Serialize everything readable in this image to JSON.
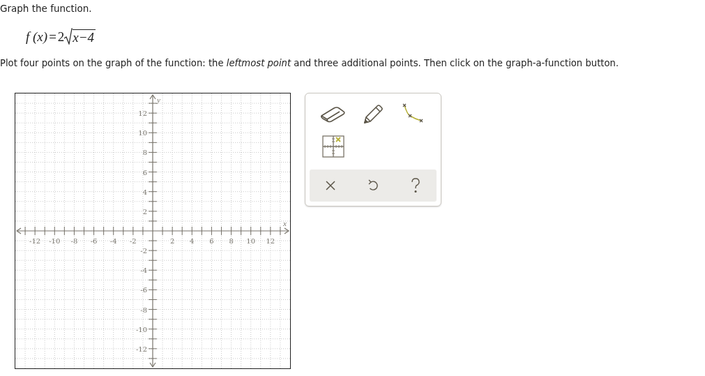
{
  "heading": "Graph the function.",
  "formula": {
    "lhs": "f (x)",
    "equals": "=",
    "coefficient": "2",
    "radicand": "x−4"
  },
  "instruction": "Plot four points on the graph of the function: the *leftmost point* and three additional points. Then click on the graph-a-function button.",
  "graph": {
    "x_axis_label": "x",
    "y_axis_label": "y",
    "x_tick_labels": [
      "-12",
      "-10",
      "-8",
      "-6",
      "-4",
      "-2",
      "2",
      "4",
      "6",
      "8",
      "10",
      "12"
    ],
    "y_tick_labels": [
      "12",
      "10",
      "8",
      "6",
      "4",
      "2",
      "-2",
      "-4",
      "-6",
      "-8",
      "-10",
      "-12"
    ]
  },
  "tools": [
    {
      "kind": "eraser"
    },
    {
      "kind": "pencil"
    },
    {
      "kind": "curve"
    },
    {
      "kind": "point"
    }
  ],
  "actions": [
    {
      "kind": "clear"
    },
    {
      "kind": "undo"
    },
    {
      "kind": "help"
    }
  ]
}
